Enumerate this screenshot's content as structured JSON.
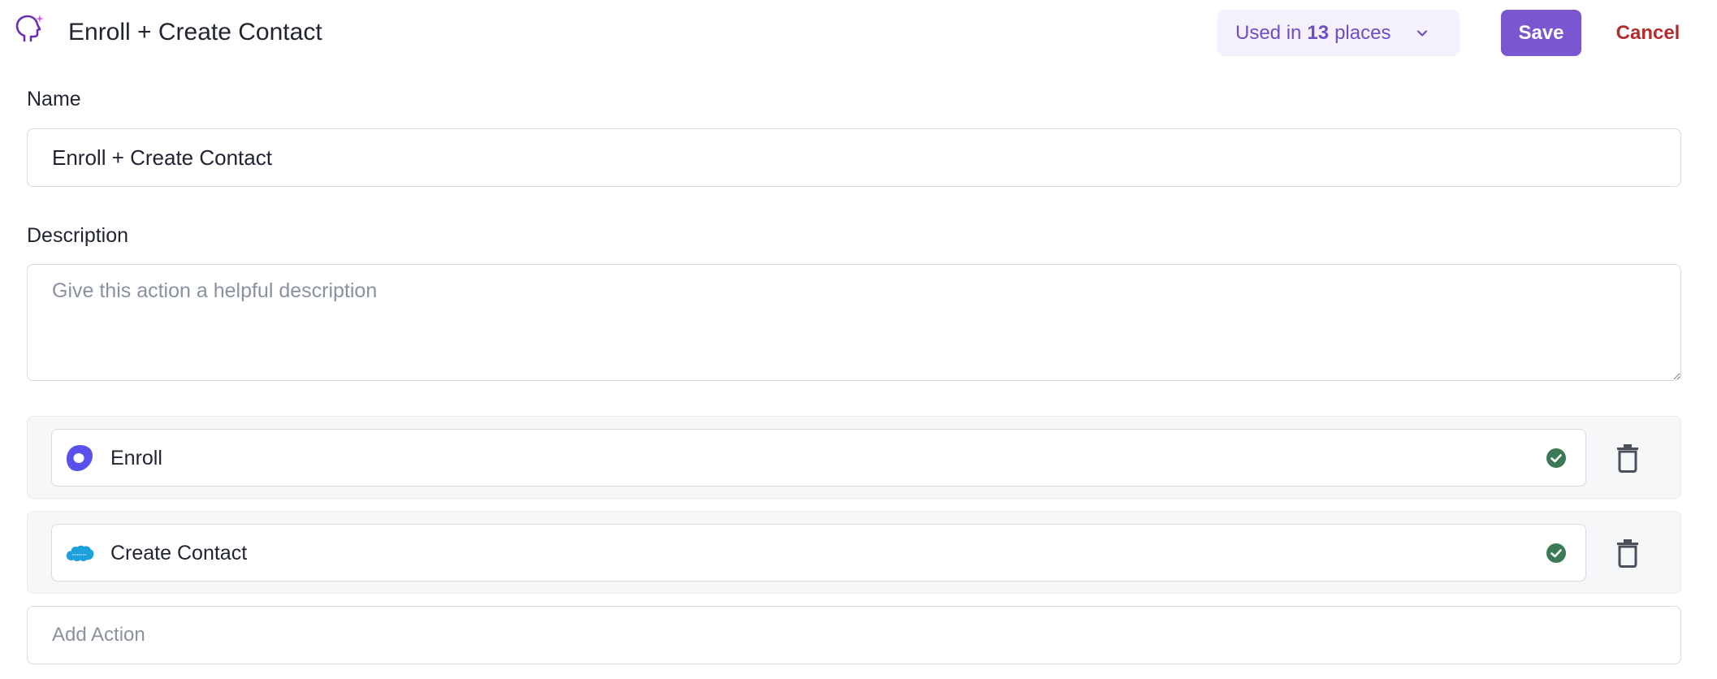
{
  "header": {
    "app_icon": "head-sparkle-icon",
    "title": "Enroll + Create Contact",
    "used_in": {
      "prefix": "Used in",
      "count": "13",
      "suffix": "places"
    },
    "save_label": "Save",
    "cancel_label": "Cancel"
  },
  "form": {
    "name_label": "Name",
    "name_value": "Enroll + Create Contact",
    "description_label": "Description",
    "description_value": "",
    "description_placeholder": "Give this action a helpful description"
  },
  "actions": [
    {
      "name": "Enroll",
      "logo": "outreach-logo",
      "status": "valid"
    },
    {
      "name": "Create Contact",
      "logo": "salesforce-logo",
      "status": "valid"
    }
  ],
  "add_action_placeholder": "Add Action",
  "colors": {
    "accent": "#7a57d1",
    "accent_text": "#6b4fc4",
    "accent_bg": "#f4f1fd",
    "cancel": "#b32d2d",
    "success": "#3c7a55",
    "outreach": "#5951ea",
    "salesforce": "#1ea0dd"
  }
}
